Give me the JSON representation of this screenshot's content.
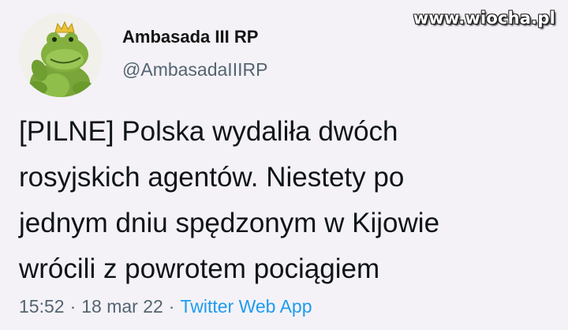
{
  "watermark": "www.wiocha.pl",
  "author": {
    "display_name": "Ambasada III RP",
    "handle": "@AmbasadaIIIRP",
    "avatar_icon": "frog-prince-avatar"
  },
  "tweet": {
    "lines": [
      "[PILNE] Polska wydaliła dwóch",
      "rosyjskich agentów. Niestety po",
      "jednym dniu spędzonym w Kijowie",
      "wrócili z powrotem pociągiem"
    ]
  },
  "meta": {
    "time": "15:52",
    "separator": "·",
    "date": "18 mar 22",
    "source": "Twitter Web App"
  },
  "colors": {
    "background": "#f4f2f7",
    "text": "#0f1419",
    "secondary": "#536471",
    "link": "#1d9bf0"
  }
}
